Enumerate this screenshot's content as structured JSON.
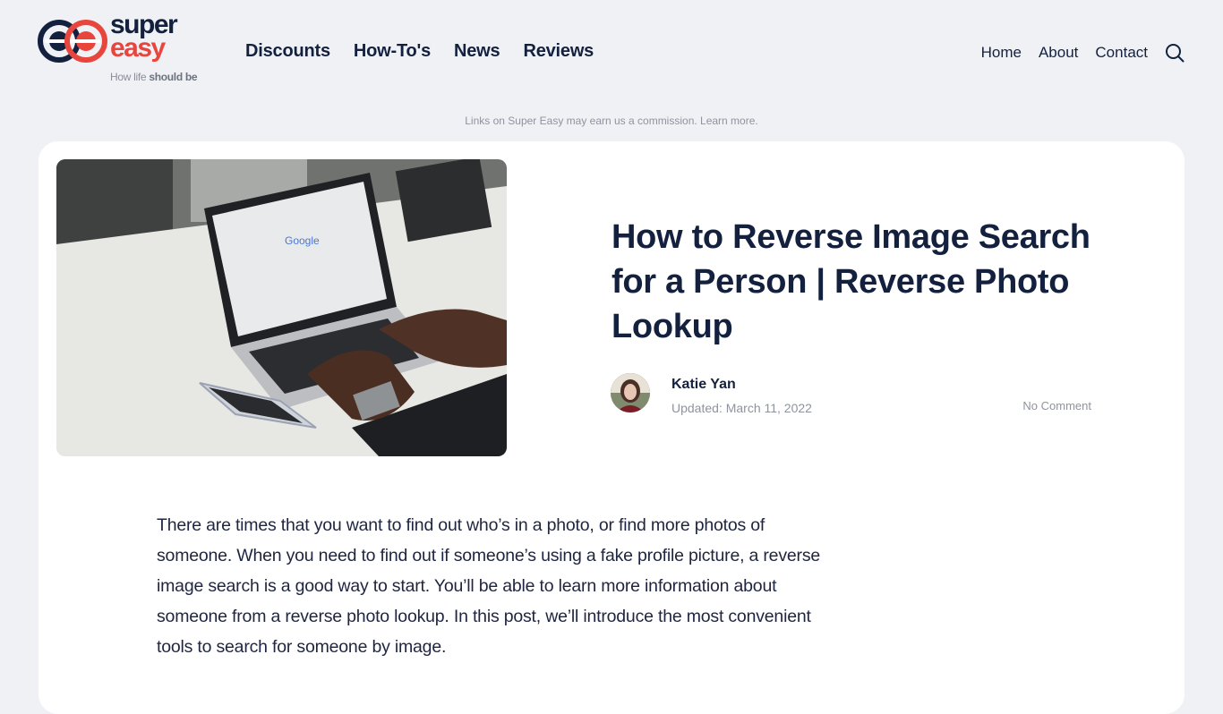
{
  "brand": {
    "word_top": "super",
    "word_bottom": "easy",
    "tagline_light": "How life ",
    "tagline_bold": "should be",
    "colors": {
      "navy": "#13213f",
      "red": "#e8453c"
    }
  },
  "main_nav": [
    {
      "label": "Discounts"
    },
    {
      "label": "How-To's"
    },
    {
      "label": "News"
    },
    {
      "label": "Reviews"
    }
  ],
  "secondary_nav": [
    {
      "label": "Home"
    },
    {
      "label": "About"
    },
    {
      "label": "Contact"
    }
  ],
  "search_icon": "search-icon",
  "disclaimer": {
    "text": "Links on Super Easy may earn us a commission. ",
    "link": "Learn more."
  },
  "article": {
    "hero_image_alt": "Person typing on a laptop showing Google search page, with a phone and desk phone nearby",
    "title": "How to Reverse Image Search for a Person | Reverse Photo Lookup",
    "author": "Katie Yan",
    "updated": "Updated: March 11, 2022",
    "comments": "No Comment",
    "intro": "There are times that you want to find out who’s in a photo, or find more photos of someone. When you need to find out if someone’s using a fake profile picture, a reverse image search is a good way to start. You’ll be able to learn more information about someone from a reverse photo lookup. In this post, we’ll introduce the most convenient tools to search for someone by image."
  }
}
